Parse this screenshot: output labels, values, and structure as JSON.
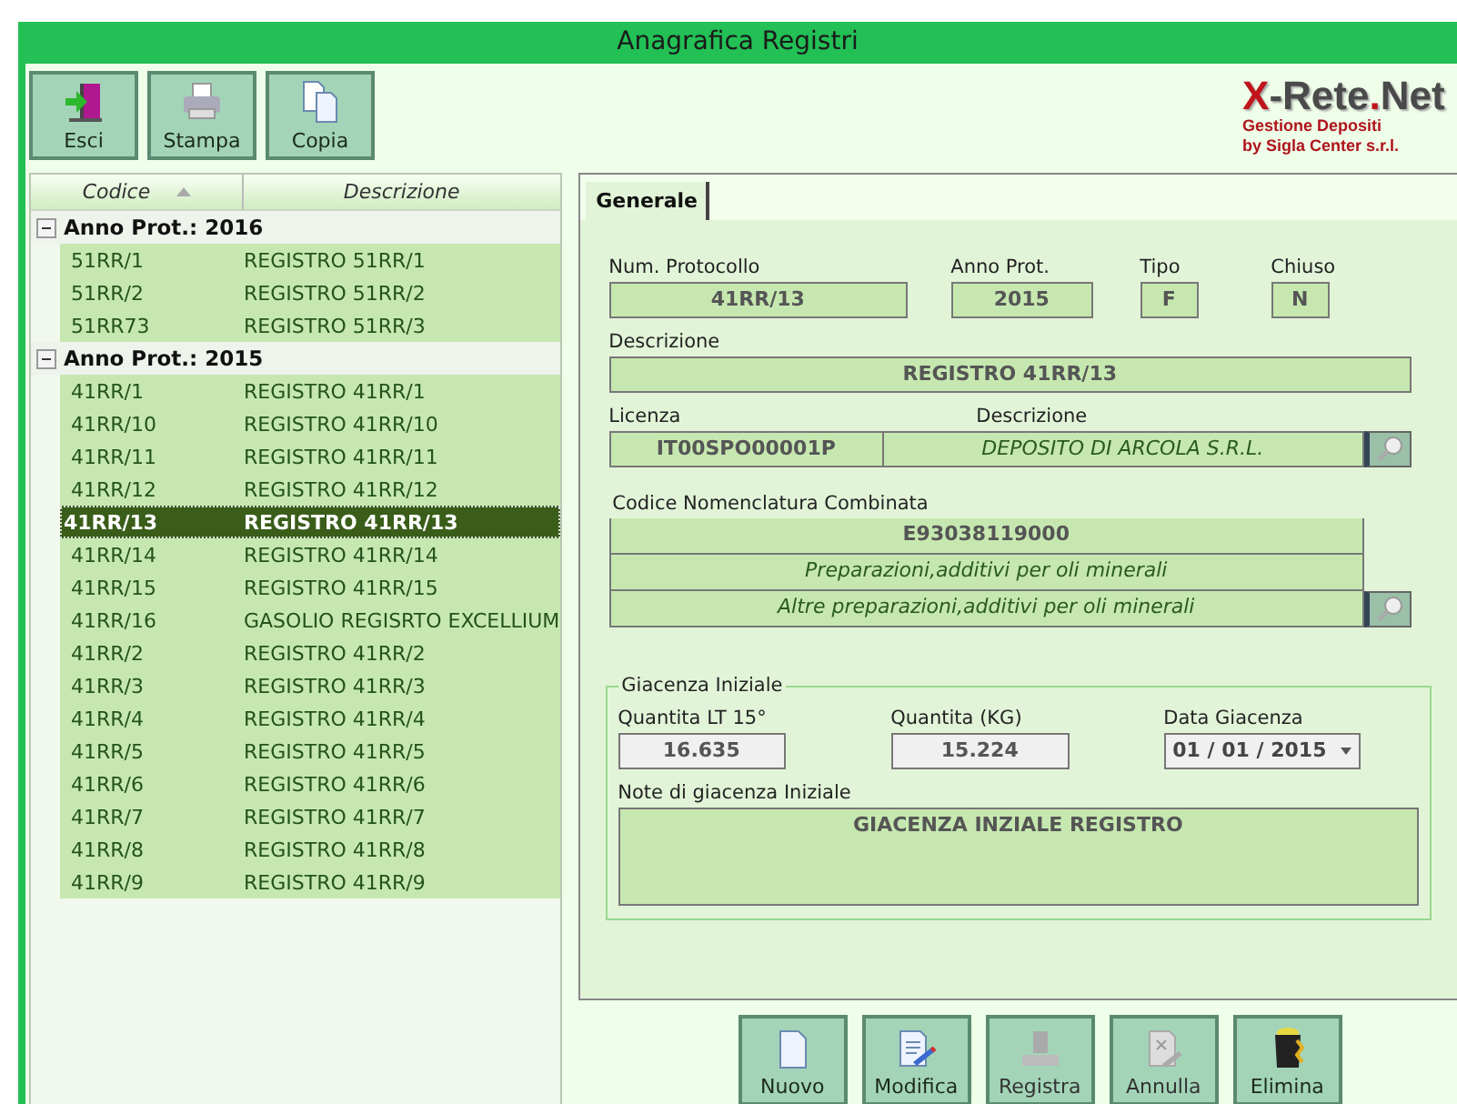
{
  "window": {
    "title": "Anagrafica Registri"
  },
  "toolbar": [
    {
      "label": "Esci",
      "kind": "exit"
    },
    {
      "label": "Stampa",
      "kind": "print"
    },
    {
      "label": "Copia",
      "kind": "copy"
    }
  ],
  "logo": {
    "segments": [
      {
        "text": "X",
        "accent": true
      },
      {
        "text": "-Rete",
        "accent": false
      },
      {
        "text": ".",
        "accent": true
      },
      {
        "text": "Net",
        "accent": false
      }
    ],
    "subtitle": "Gestione Depositi",
    "credit": "by Sigla Center s.r.l."
  },
  "grid": {
    "columns": [
      {
        "label": "Codice",
        "sorted": true
      },
      {
        "label": "Descrizione",
        "sorted": false
      }
    ],
    "groups": [
      {
        "label": "Anno Prot.: 2016",
        "expanded": true,
        "rows": [
          {
            "code": "51RR/1",
            "description": "REGISTRO 51RR/1",
            "selected": false
          },
          {
            "code": "51RR/2",
            "description": "REGISTRO 51RR/2",
            "selected": false
          },
          {
            "code": "51RR73",
            "description": "REGISTRO 51RR/3",
            "selected": false
          }
        ]
      },
      {
        "label": "Anno Prot.: 2015",
        "expanded": true,
        "rows": [
          {
            "code": "41RR/1",
            "description": "REGISTRO 41RR/1",
            "selected": false
          },
          {
            "code": "41RR/10",
            "description": "REGISTRO 41RR/10",
            "selected": false
          },
          {
            "code": "41RR/11",
            "description": "REGISTRO 41RR/11",
            "selected": false
          },
          {
            "code": "41RR/12",
            "description": "REGISTRO 41RR/12",
            "selected": false
          },
          {
            "code": "41RR/13",
            "description": "REGISTRO 41RR/13",
            "selected": true
          },
          {
            "code": "41RR/14",
            "description": "REGISTRO 41RR/14",
            "selected": false
          },
          {
            "code": "41RR/15",
            "description": "REGISTRO 41RR/15",
            "selected": false
          },
          {
            "code": "41RR/16",
            "description": "GASOLIO REGISRTO EXCELLIUM",
            "selected": false
          },
          {
            "code": "41RR/2",
            "description": "REGISTRO 41RR/2",
            "selected": false
          },
          {
            "code": "41RR/3",
            "description": "REGISTRO 41RR/3",
            "selected": false
          },
          {
            "code": "41RR/4",
            "description": "REGISTRO 41RR/4",
            "selected": false
          },
          {
            "code": "41RR/5",
            "description": "REGISTRO 41RR/5",
            "selected": false
          },
          {
            "code": "41RR/6",
            "description": "REGISTRO 41RR/6",
            "selected": false
          },
          {
            "code": "41RR/7",
            "description": "REGISTRO 41RR/7",
            "selected": false
          },
          {
            "code": "41RR/8",
            "description": "REGISTRO 41RR/8",
            "selected": false
          },
          {
            "code": "41RR/9",
            "description": "REGISTRO 41RR/9",
            "selected": false
          }
        ]
      }
    ]
  },
  "tabs": [
    {
      "label": "Generale",
      "selected": true
    }
  ],
  "form": {
    "protocol": {
      "label": "Num. Protocollo",
      "value": "41RR/13"
    },
    "year": {
      "label": "Anno Prot.",
      "value": "2015"
    },
    "type": {
      "label": "Tipo",
      "value": "F"
    },
    "closed": {
      "label": "Chiuso",
      "value": "N"
    },
    "description": {
      "label": "Descrizione",
      "value": "REGISTRO 41RR/13"
    },
    "license": {
      "label": "Licenza",
      "value": "IT00SPO00001P"
    },
    "license_description": {
      "label": "Descrizione",
      "value": "DEPOSITO DI ARCOLA S.R.L."
    },
    "nomenclature": {
      "label": "Codice Nomenclatura Combinata",
      "value": "E93038119000",
      "line_1": "Preparazioni,additivi per oli minerali",
      "line_2": "Altre preparazioni,additivi per oli minerali"
    }
  },
  "stock": {
    "title": "Giacenza Iniziale",
    "quantity_lt": {
      "label": "Quantita LT 15°",
      "value": "16.635"
    },
    "quantity_kg": {
      "label": "Quantita (KG)",
      "value": "15.224"
    },
    "date": {
      "label": "Data Giacenza",
      "value": "01 / 01 / 2015"
    },
    "notes": {
      "label": "Note di giacenza Iniziale",
      "value": "GIACENZA INZIALE REGISTRO"
    }
  },
  "actions": [
    {
      "label": "Nuovo",
      "kind": "new",
      "disabled": false
    },
    {
      "label": "Modifica",
      "kind": "edit",
      "disabled": false
    },
    {
      "label": "Registra",
      "kind": "save",
      "disabled": true
    },
    {
      "label": "Annulla",
      "kind": "cancel",
      "disabled": true
    },
    {
      "label": "Elimina",
      "kind": "delete",
      "disabled": false
    }
  ]
}
